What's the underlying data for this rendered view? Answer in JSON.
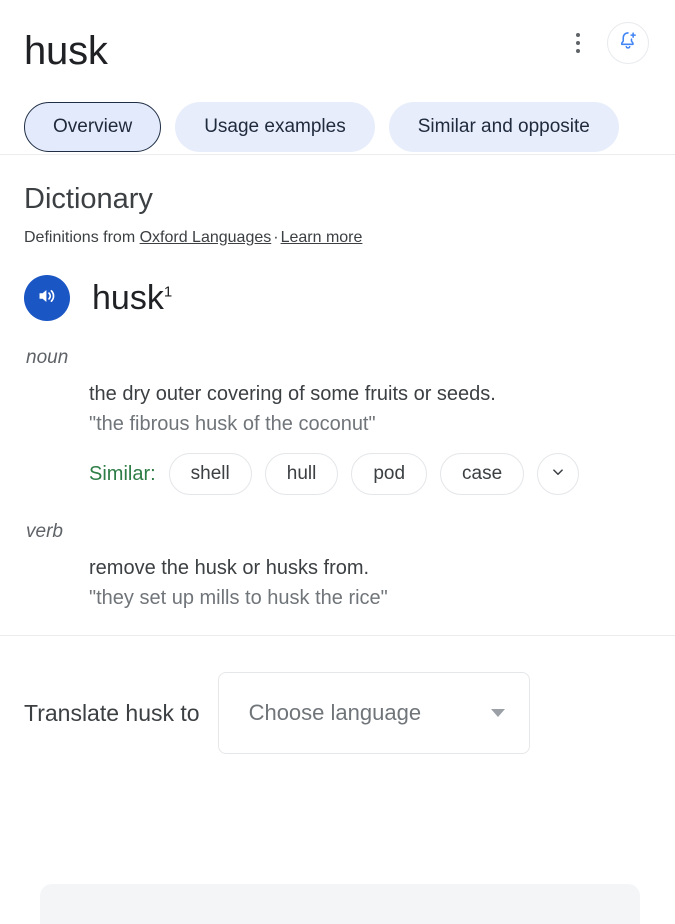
{
  "header": {
    "word": "husk",
    "kebab_icon": "more-vert-icon",
    "notify_icon": "bell-add-icon",
    "tabs": [
      {
        "label": "Overview",
        "selected": true
      },
      {
        "label": "Usage examples",
        "selected": false
      },
      {
        "label": "Similar and opposite",
        "selected": false
      }
    ]
  },
  "dictionary": {
    "heading": "Dictionary",
    "source_prefix": "Definitions from ",
    "source_link": "Oxford Languages",
    "source_separator": "·",
    "learn_more": "Learn more",
    "headword": "husk",
    "headword_sup": "1",
    "audio_icon": "speaker-icon",
    "entries": [
      {
        "part_of_speech": "noun",
        "definition": "the dry outer covering of some fruits or seeds.",
        "example": "\"the fibrous husk of the coconut\"",
        "similar_label": "Similar:",
        "similar_terms": [
          "shell",
          "hull",
          "pod",
          "case"
        ],
        "expand_icon": "chevron-down-icon"
      },
      {
        "part_of_speech": "verb",
        "definition": "remove the husk or husks from.",
        "example": "\"they set up mills to husk the rice\"",
        "similar_label": "",
        "similar_terms": [],
        "expand_icon": ""
      }
    ]
  },
  "translate": {
    "label": "Translate husk to",
    "select_value": "Choose language",
    "caret_icon": "caret-down-icon"
  },
  "colors": {
    "accent_blue": "#1a56c4",
    "tab_chip_bg": "#e7edfb",
    "tab_selected_border": "#202f45",
    "similar_green": "#2e7d46",
    "card_gray": "#f4f5f7"
  }
}
